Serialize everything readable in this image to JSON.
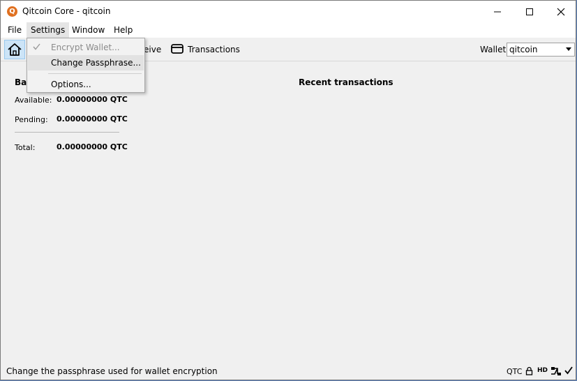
{
  "window": {
    "title": "Qitcoin Core - qitcoin",
    "app_icon_letter": "Q",
    "accent_color": "#e07020"
  },
  "menubar": {
    "file": "File",
    "settings": "Settings",
    "window": "Window",
    "help": "Help"
  },
  "settings_menu": {
    "items": [
      {
        "label": "Encrypt Wallet...",
        "state": "disabled-checked"
      },
      {
        "label": "Change Passphrase...",
        "state": "highlighted"
      },
      {
        "label": "Options...",
        "state": "normal"
      }
    ]
  },
  "toolbar": {
    "overview_icon": "home-icon",
    "receive_partial_label": "eive",
    "transactions_icon": "transactions-card-icon",
    "transactions_label": "Transactions",
    "wallet_label": "Wallet:",
    "wallet_selected": "qitcoin"
  },
  "overview": {
    "balances_title_partial": "Bal",
    "available_label": "Available:",
    "available_value": "0.00000000 QTC",
    "pending_label": "Pending:",
    "pending_value": "0.00000000 QTC",
    "total_label": "Total:",
    "total_value": "0.00000000 QTC",
    "recent_title": "Recent transactions"
  },
  "statusbar": {
    "message": "Change the passphrase used for wallet encryption",
    "unit": "QTC",
    "hd_label": "HD",
    "icons": [
      "lock-icon",
      "network-icon",
      "sync-check-icon"
    ]
  }
}
